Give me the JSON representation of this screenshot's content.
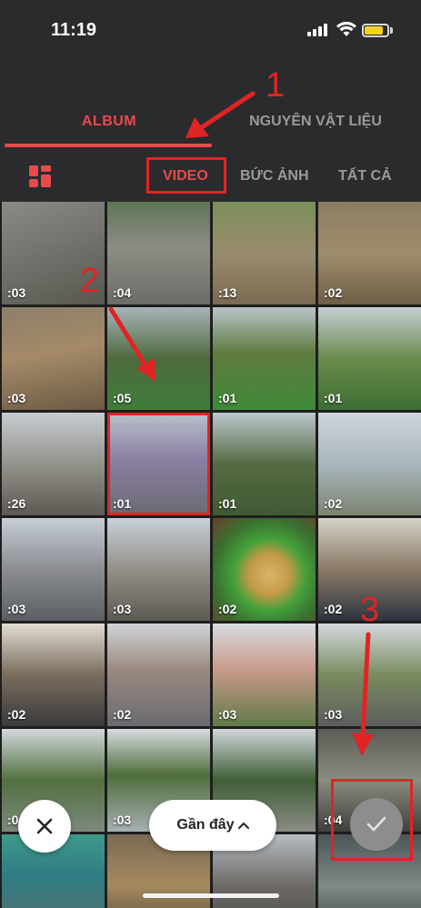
{
  "status_bar": {
    "time": "11:19"
  },
  "tabs": [
    {
      "label": "ALBUM",
      "active": true
    },
    {
      "label": "NGUYÊN VẬT LIỆU",
      "active": false
    }
  ],
  "filters": [
    {
      "label": "VIDEO",
      "active": true
    },
    {
      "label": "BỨC ẢNH",
      "active": false
    },
    {
      "label": "TẤT CẢ",
      "active": false
    }
  ],
  "thumbnails": [
    {
      "duration": ":03",
      "scene": "concrete"
    },
    {
      "duration": ":04",
      "scene": "path"
    },
    {
      "duration": ":13",
      "scene": "dogs-yard"
    },
    {
      "duration": ":02",
      "scene": "dogs-yard2"
    },
    {
      "duration": ":03",
      "scene": "dog-closeup"
    },
    {
      "duration": ":05",
      "scene": "park"
    },
    {
      "duration": ":01",
      "scene": "park2"
    },
    {
      "duration": ":01",
      "scene": "garden"
    },
    {
      "duration": ":26",
      "scene": "street-building"
    },
    {
      "duration": ":01",
      "scene": "castle",
      "selected": true
    },
    {
      "duration": ":01",
      "scene": "trees"
    },
    {
      "duration": ":02",
      "scene": "lake"
    },
    {
      "duration": ":03",
      "scene": "buildings"
    },
    {
      "duration": ":03",
      "scene": "town"
    },
    {
      "duration": ":02",
      "scene": "food"
    },
    {
      "duration": ":02",
      "scene": "crowd-indoor"
    },
    {
      "duration": ":02",
      "scene": "crowd-cafe"
    },
    {
      "duration": ":02",
      "scene": "market-street"
    },
    {
      "duration": ":03",
      "scene": "cathedral"
    },
    {
      "duration": ":03",
      "scene": "church-road"
    },
    {
      "duration": ":04",
      "scene": "lakeside"
    },
    {
      "duration": ":03",
      "scene": "lake-trees"
    },
    {
      "duration": "",
      "scene": "pine-road"
    },
    {
      "duration": ":04",
      "scene": "alley"
    },
    {
      "duration": "",
      "scene": "shopfront"
    },
    {
      "duration": "",
      "scene": "shop2"
    },
    {
      "duration": "",
      "scene": "street-bottom"
    },
    {
      "duration": "",
      "scene": "alley2"
    }
  ],
  "bottom": {
    "recent_label": "Gần đây"
  },
  "annotations": {
    "step1": "1",
    "step2": "2",
    "step3": "3"
  },
  "colors": {
    "accent": "#e84a4a",
    "annotation": "#e02424",
    "background": "#2b2b2d"
  }
}
